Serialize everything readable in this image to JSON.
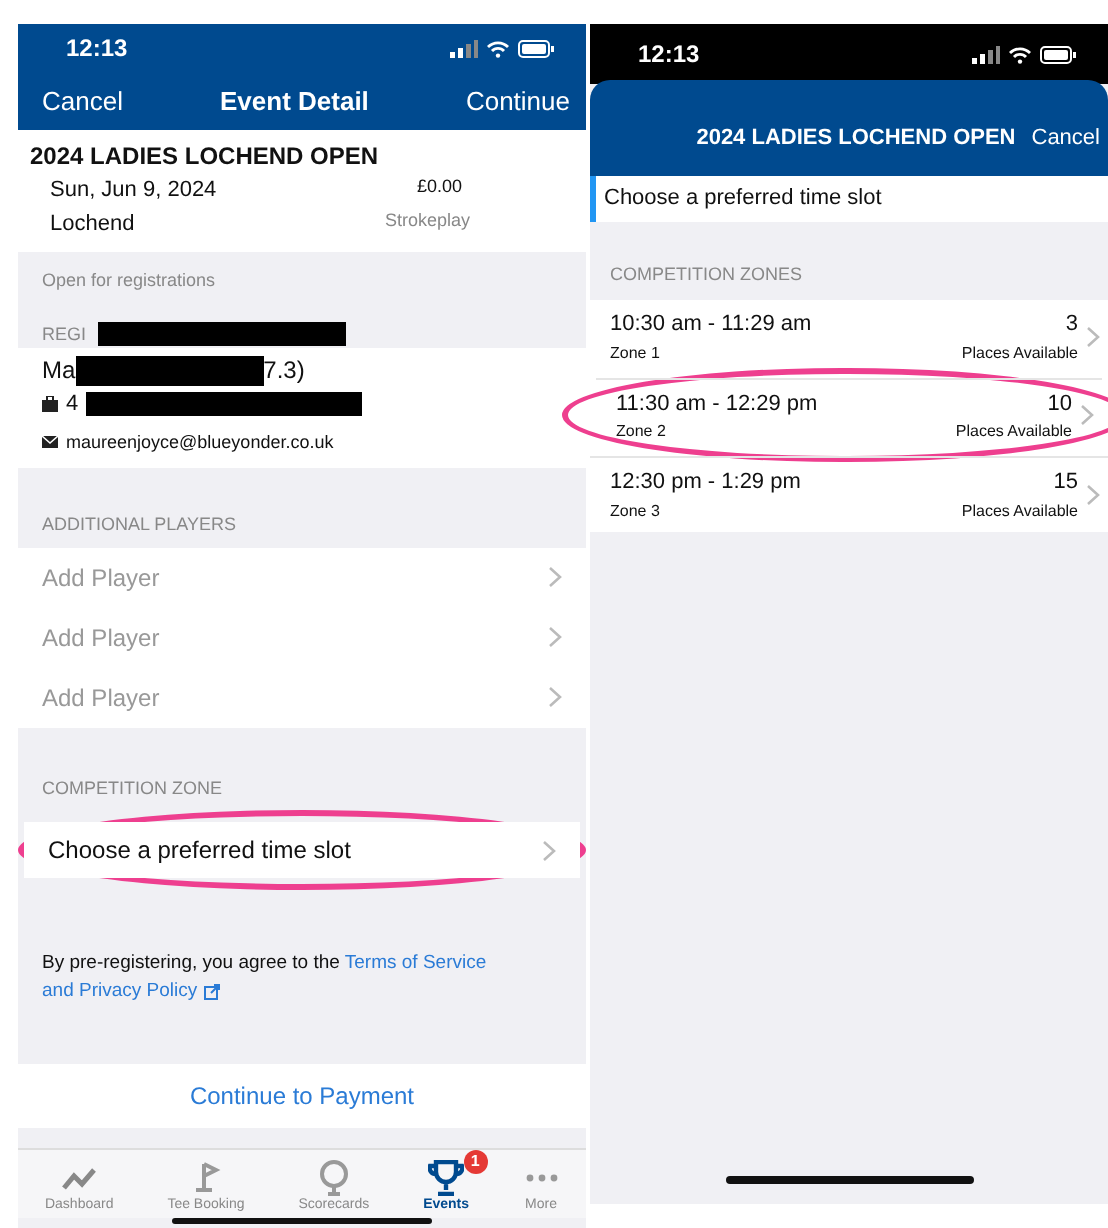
{
  "left_screen": {
    "status_bar": {
      "time": "12:13"
    },
    "nav": {
      "cancel": "Cancel",
      "title": "Event Detail",
      "continue": "Continue"
    },
    "event": {
      "name": "2024 LADIES LOCHEND OPEN",
      "date": "Sun, Jun 9, 2024",
      "price": "£0.00",
      "venue": "Lochend",
      "format": "Strokeplay"
    },
    "status_text": "Open for registrations",
    "registration": {
      "header": "REGI",
      "name_start": "Ma",
      "name_end": "7.3)",
      "id_start": "4",
      "email": "maureenjoyce@blueyonder.co.uk"
    },
    "additional_players": {
      "header": "ADDITIONAL PLAYERS",
      "rows": [
        "Add Player",
        "Add Player",
        "Add Player"
      ]
    },
    "competition_zone": {
      "header": "COMPETITION ZONE",
      "row": "Choose a preferred time slot",
      "highlighted": true
    },
    "terms": {
      "text": "By pre-registering, you agree to the",
      "link_lines": [
        "Terms of Service",
        "and Privacy Policy"
      ]
    },
    "continue_button": "Continue to Payment",
    "tab_bar": [
      {
        "kind": "dashboard",
        "label": "Dashboard",
        "selected": false
      },
      {
        "kind": "tee",
        "label": "Tee Booking",
        "selected": false
      },
      {
        "kind": "scorecards",
        "label": "Scorecards",
        "selected": false
      },
      {
        "kind": "events",
        "label": "Events",
        "selected": true,
        "badge": "1"
      },
      {
        "kind": "more",
        "label": "More",
        "selected": false
      }
    ]
  },
  "right_screen": {
    "status_bar": {
      "time": "12:13"
    },
    "sheet": {
      "title": "2024 LADIES LOCHEND OPEN",
      "cancel": "Cancel"
    },
    "selected_field": "Choose a preferred time slot",
    "zones_header": "COMPETITION ZONES",
    "zones": [
      {
        "time": "10:30 am - 11:29 am",
        "zone": "Zone 1",
        "places": "3",
        "places_label": "Places Available",
        "highlighted": false
      },
      {
        "time": "11:30 am - 12:29 pm",
        "zone": "Zone 2",
        "places": "10",
        "places_label": "Places Available",
        "highlighted": true
      },
      {
        "time": "12:30 pm - 1:29 pm",
        "zone": "Zone 3",
        "places": "15",
        "places_label": "Places Available",
        "highlighted": false
      }
    ]
  }
}
